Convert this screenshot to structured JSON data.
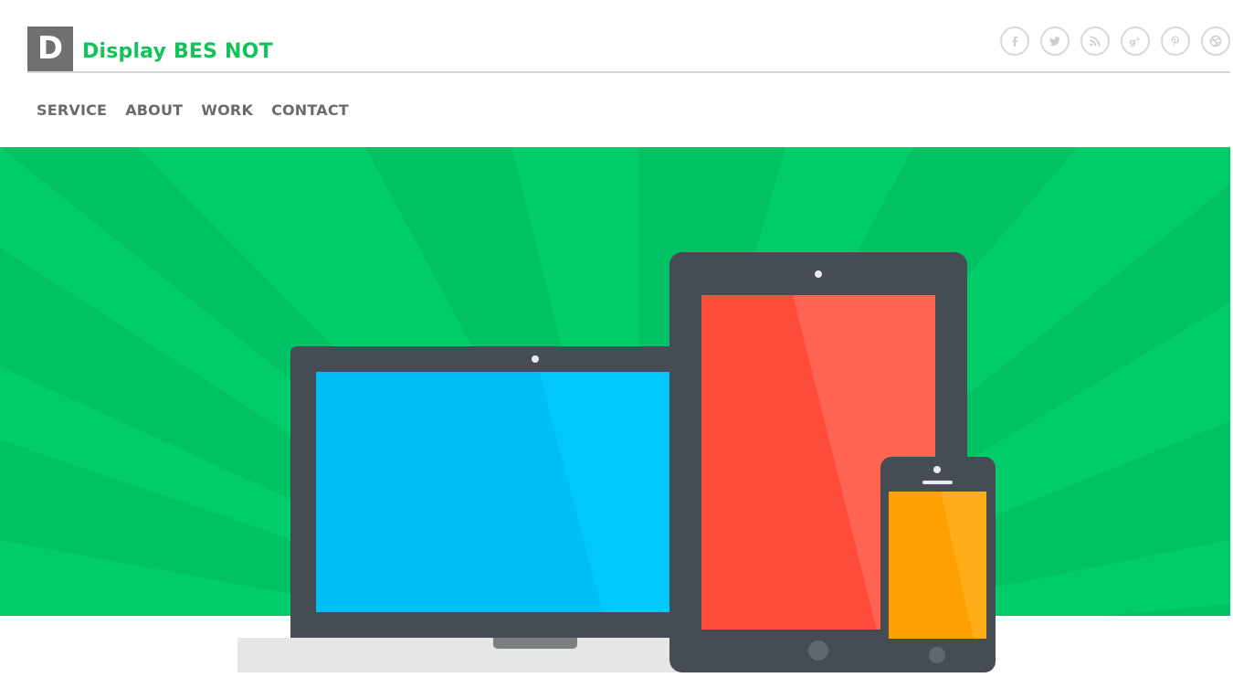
{
  "header": {
    "logo_letter": "D",
    "site_title": "Display BES NOT",
    "social_icons": [
      {
        "name": "facebook-icon",
        "glyph": "f"
      },
      {
        "name": "twitter-icon",
        "glyph": "t"
      },
      {
        "name": "rss-icon",
        "glyph": "rss"
      },
      {
        "name": "google-plus-icon",
        "glyph": "g+"
      },
      {
        "name": "pinterest-icon",
        "glyph": "p"
      },
      {
        "name": "dribbble-icon",
        "glyph": "d"
      }
    ]
  },
  "nav": {
    "items": [
      "SERVICE",
      "ABOUT",
      "WORK",
      "CONTACT"
    ]
  },
  "colors": {
    "brand_green": "#12c25a",
    "hero_green": "#00cc6a",
    "device_frame": "#454c54",
    "laptop_screen": "#00bff6",
    "tablet_screen": "#ff4c3b",
    "phone_screen": "#ff9f00"
  }
}
